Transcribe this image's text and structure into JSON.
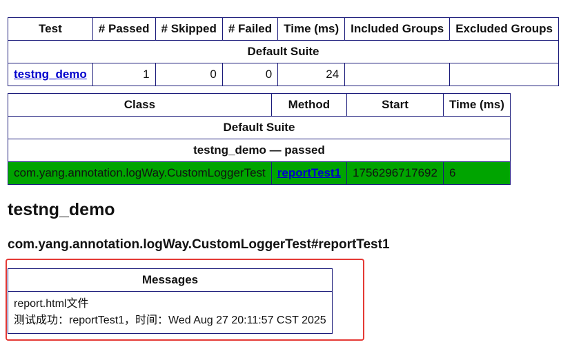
{
  "summary_table": {
    "headers": [
      "Test",
      "# Passed",
      "# Skipped",
      "# Failed",
      "Time (ms)",
      "Included Groups",
      "Excluded Groups"
    ],
    "suite_label": "Default Suite",
    "row": {
      "test": "testng_demo",
      "passed": "1",
      "skipped": "0",
      "failed": "0",
      "time": "24",
      "included": "",
      "excluded": ""
    }
  },
  "method_table": {
    "headers": [
      "Class",
      "Method",
      "Start",
      "Time (ms)"
    ],
    "suite_label": "Default Suite",
    "test_status": "testng_demo — passed",
    "row": {
      "class": "com.yang.annotation.logWay.CustomLoggerTest",
      "method": "reportTest1",
      "start": "1756296717692",
      "time": "6"
    }
  },
  "test_heading": "testng_demo",
  "method_heading": "com.yang.annotation.logWay.CustomLoggerTest#reportTest1",
  "messages": {
    "header": "Messages",
    "lines": [
      "report.html文件",
      "测试成功：reportTest1，时间：Wed Aug 27 20:11:57 CST 2025"
    ]
  },
  "colors": {
    "passed_row": "#00a400",
    "table_border": "#1a1a7a",
    "link": "#0000cc",
    "highlight": "#e53935"
  }
}
